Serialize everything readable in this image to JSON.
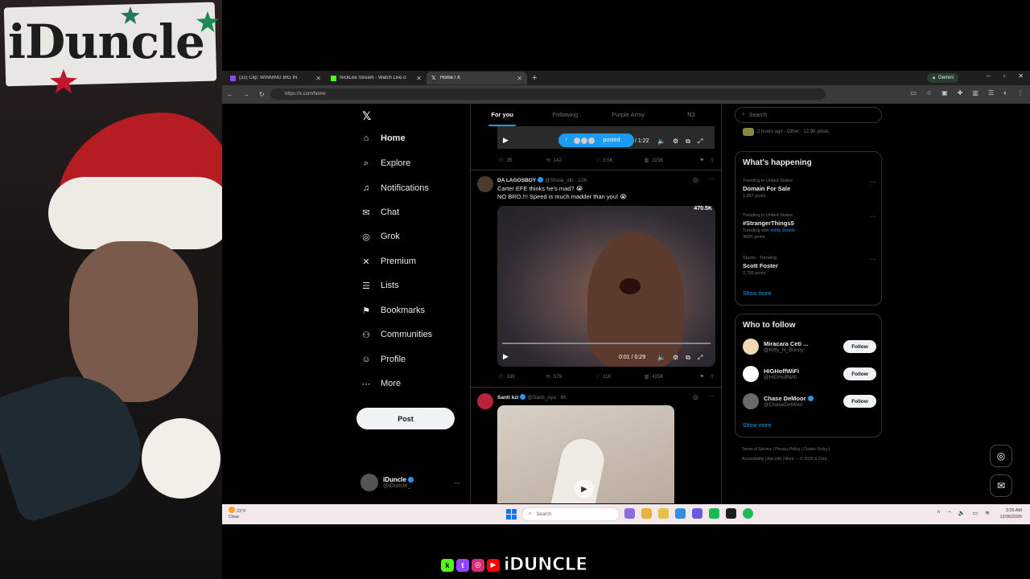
{
  "overlay": {
    "sign_text": "iDuncle",
    "brand_text": "iDUNCLE",
    "brand_icons": [
      "kick-icon",
      "twitch-icon",
      "instagram-icon",
      "youtube-icon"
    ]
  },
  "browser": {
    "tabs": [
      {
        "title": "(32) Clip: WINNING BIG IN",
        "icon": "twitch-icon",
        "active": false
      },
      {
        "title": "NickLee Stream - Watch Live o",
        "icon": "kick-icon",
        "active": false
      },
      {
        "title": "Home / X",
        "icon": "x-icon",
        "active": true
      }
    ],
    "gemini_label": "Gemini",
    "url": "https://x.com/home"
  },
  "nav": {
    "items": [
      {
        "label": "Home",
        "icon": "home-icon",
        "glyph": "⌂"
      },
      {
        "label": "Explore",
        "icon": "search-icon",
        "glyph": "⌕"
      },
      {
        "label": "Notifications",
        "icon": "bell-icon",
        "glyph": "♫"
      },
      {
        "label": "Chat",
        "icon": "mail-icon",
        "glyph": "✉"
      },
      {
        "label": "Grok",
        "icon": "grok-icon",
        "glyph": "◎"
      },
      {
        "label": "Premium",
        "icon": "x-icon",
        "glyph": "✕"
      },
      {
        "label": "Lists",
        "icon": "list-icon",
        "glyph": "☰"
      },
      {
        "label": "Bookmarks",
        "icon": "bookmark-icon",
        "glyph": "⚑"
      },
      {
        "label": "Communities",
        "icon": "people-icon",
        "glyph": "⚇"
      },
      {
        "label": "Profile",
        "icon": "person-icon",
        "glyph": "☺"
      },
      {
        "label": "More",
        "icon": "more-icon",
        "glyph": "⋯"
      }
    ],
    "post_label": "Post",
    "user": {
      "name": "iDuncle",
      "handle": "@iDuncle_"
    }
  },
  "timeline": {
    "tabs": [
      "For you",
      "Following",
      "Purple Army",
      "N3"
    ],
    "top_video": {
      "time": "/ 1:22",
      "posted_label": "posted",
      "actions": {
        "replies": "35",
        "reposts": "142",
        "likes": "3.5K",
        "views": "223K"
      }
    },
    "posts": [
      {
        "name": "DA LAGOSBOY",
        "handle": "@Shola_dib",
        "time": "22h",
        "lines": [
          "Carter EFE thinks he's mad? 😭",
          "NO BRO.!!! Speed is much madder than you! 😭"
        ],
        "video_time": "0:01 / 0:29",
        "video_count": "470.5K",
        "actions": {
          "replies": "135",
          "reposts": "579",
          "likes": "11K",
          "views": "425K"
        }
      },
      {
        "name": "Santi kzl",
        "handle": "@Santi_nya",
        "time": "6h"
      }
    ]
  },
  "right": {
    "search_placeholder": "Search",
    "sub_line": "2 hours ago · Other · 12.9K posts",
    "happening_title": "What's happening",
    "trends": [
      {
        "meta": "Trending in United States",
        "name": "Domain For Sale",
        "count": "1,857 posts",
        "with": ""
      },
      {
        "meta": "Trending in United States",
        "name": "#StrangerThings5",
        "count": "382K posts",
        "with_prefix": "Trending with",
        "with": "Holly, Dustin"
      },
      {
        "meta": "Sports · Trending",
        "name": "Scott Foster",
        "count": "2,795 posts",
        "with": ""
      }
    ],
    "show_more": "Show more",
    "who_title": "Who to follow",
    "who": [
      {
        "name": "Miracara Ceti ...",
        "handle": "@Kitty_N_Bunny",
        "verified": false,
        "follow": "Follow"
      },
      {
        "name": "HIGHoffWiFi",
        "handle": "@HIGHoffWifi",
        "verified": false,
        "follow": "Follow"
      },
      {
        "name": "Chase DeMoor",
        "handle": "@ChaseDeMoor",
        "verified": true,
        "follow": "Follow"
      }
    ],
    "footer_line1": "Terms of Service  |  Privacy Policy  |  Cookie Policy  |",
    "footer_line2": "Accessibility  |  Ads info  |  More ···  © 2025 X Corp."
  },
  "taskbar": {
    "temp": "23°F",
    "weather": "Clear",
    "search": "Search",
    "time": "3:26 AM",
    "date": "12/26/2025"
  },
  "colors": {
    "accent": "#1d9bf0",
    "background": "#000000",
    "text": "#e7e9ea",
    "muted": "#71767b"
  }
}
